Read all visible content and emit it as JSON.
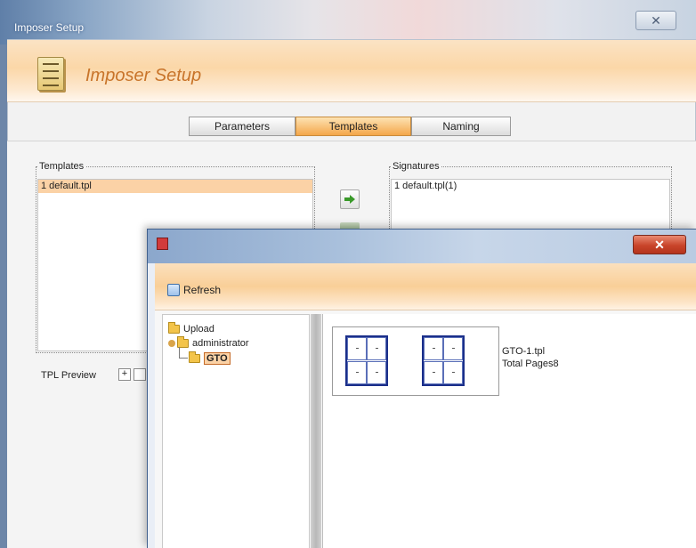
{
  "outer_window": {
    "title": "Imposer Setup",
    "close_glyph": "✕"
  },
  "header": {
    "title": "Imposer Setup",
    "icon": "document-stack-icon"
  },
  "tabs": [
    {
      "label": "Parameters",
      "active": false
    },
    {
      "label": "Templates",
      "active": true
    },
    {
      "label": "Naming",
      "active": false
    }
  ],
  "templates_group": {
    "label": "Templates",
    "items": [
      {
        "text": "1  default.tpl",
        "selected": true
      }
    ]
  },
  "signatures_group": {
    "label": "Signatures",
    "items": [
      {
        "text": "1  default.tpl(1)",
        "selected": false
      }
    ]
  },
  "tpl_preview": {
    "label": "TPL Preview",
    "zoom_in_glyph": "+"
  },
  "dialog": {
    "title": "",
    "close_glyph": "✕",
    "accent_color": "#c8442a",
    "toolbar": {
      "refresh_label": "Refresh",
      "refresh_icon": "refresh-icon"
    },
    "tree": {
      "root": "Upload",
      "child": "administrator",
      "grandchild": "GTO"
    },
    "file": {
      "name": "GTO-1.tpl",
      "pages": "Total Pages8"
    }
  }
}
